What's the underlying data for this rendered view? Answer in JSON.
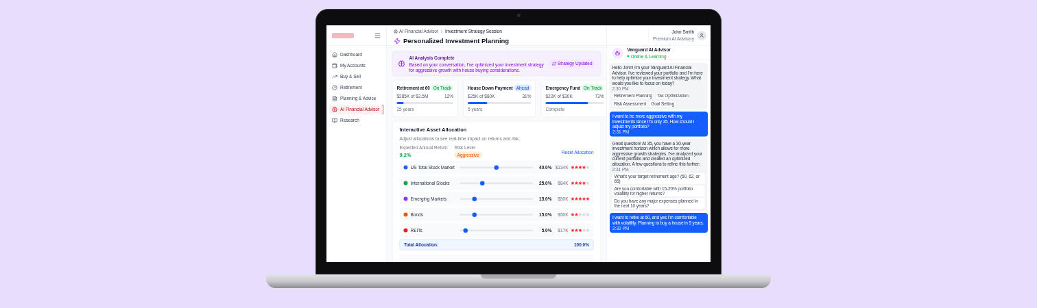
{
  "sidebar": {
    "items": [
      {
        "label": "Dashboard",
        "selected": false
      },
      {
        "label": "My Accounts",
        "selected": false
      },
      {
        "label": "Buy & Sell",
        "selected": false
      },
      {
        "label": "Retirement",
        "selected": false
      },
      {
        "label": "Planning & Advice",
        "selected": false
      },
      {
        "label": "AI Financial Advisor",
        "selected": true
      },
      {
        "label": "Research",
        "selected": false
      }
    ]
  },
  "header": {
    "breadcrumb": [
      "AI Financial Advisor",
      "Investment Strategy Session"
    ],
    "title": "Personalized Investment Planning",
    "user": {
      "name": "John Smith",
      "plan": "Premium AI Advisory"
    }
  },
  "banner": {
    "title": "AI Analysis Complete",
    "text": "Based on your conversation, I've optimized your investment strategy for aggressive growth with house buying considerations.",
    "badge": "Strategy Updated"
  },
  "goals": [
    {
      "name": "Retirement at 60",
      "status": "On Track",
      "kind": "on_track",
      "progress": "$285K of $2.5M",
      "percent": "12%",
      "level": 0.12,
      "note": "25 years"
    },
    {
      "name": "House Down Payment",
      "status": "Ahead",
      "kind": "ahead",
      "progress": "$25K of $80K",
      "percent": "31%",
      "level": 0.31,
      "note": "5 years"
    },
    {
      "name": "Emergency Fund",
      "status": "On Track",
      "kind": "on_track",
      "progress": "$22K of $30K",
      "percent": "73%",
      "level": 0.73,
      "note": "Complete"
    }
  ],
  "allocation": {
    "title": "Interactive Asset Allocation",
    "subtitle": "Adjust allocations to see real-time impact on returns and risk.",
    "return_label": "Expected Annual Return",
    "return_value": "9.2%",
    "risk_label": "Risk Level",
    "risk_value": "Aggressive",
    "reset": "Reset Allocation",
    "assets": [
      {
        "name": "US Total Stock Market",
        "color": "#2563eb",
        "level": 0.5,
        "percent": "40.0%",
        "amount": "$134K",
        "stars": 4
      },
      {
        "name": "International Stocks",
        "color": "#16a34a",
        "level": 0.31,
        "percent": "25.0%",
        "amount": "$84K",
        "stars": 4
      },
      {
        "name": "Emerging Markets",
        "color": "#9333ea",
        "level": 0.2,
        "percent": "15.0%",
        "amount": "$50K",
        "stars": 5
      },
      {
        "name": "Bonds",
        "color": "#ea580c",
        "level": 0.2,
        "percent": "15.0%",
        "amount": "$50K",
        "stars": 2
      },
      {
        "name": "REITs",
        "color": "#dc2626",
        "level": 0.08,
        "percent": "5.0%",
        "amount": "$17K",
        "stars": 3
      }
    ],
    "total_label": "Total Allocation:",
    "total_value": "100.0%"
  },
  "chat": {
    "name": "Vanguard AI Advisor",
    "status": "Online & Learning",
    "messages": [
      {
        "kind": "ai",
        "text": "Hello John! I'm your Vanguard AI Financial Advisor. I've reviewed your portfolio and I'm here to help optimize your investment strategy. What would you like to focus on today?",
        "time": "2:30 PM",
        "chips": [
          "Retirement Planning",
          "Tax Optimization",
          "Risk Assessment",
          "Goal Setting"
        ]
      },
      {
        "kind": "user",
        "text": "I want to be more aggressive with my investments since I'm only 35. How should I adjust my portfolio?",
        "time": "2:31 PM"
      },
      {
        "kind": "ai",
        "text": "Great question! At 35, you have a 30-year investment horizon which allows for more aggressive growth strategies. I've analyzed your current portfolio and created an optimized allocation. A few questions to refine this further:",
        "time": "2:31 PM",
        "options": [
          "What's your target retirement age? (60, 62, or 65)",
          "Are you comfortable with 15-20% portfolio volatility for higher returns?",
          "Do you have any major expenses planned in the next 10 years?"
        ]
      },
      {
        "kind": "user",
        "text": "I want to retire at 60, and yes I'm comfortable with volatility. Planning to buy a house in 5 years.",
        "time": "2:32 PM"
      }
    ]
  }
}
